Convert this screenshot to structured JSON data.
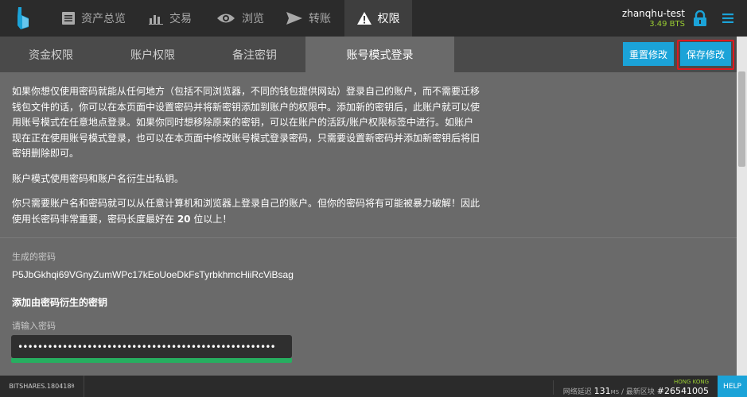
{
  "nav": {
    "items": [
      {
        "label": "资产总览",
        "icon": "dashboard-icon"
      },
      {
        "label": "交易",
        "icon": "chart-bars-icon"
      },
      {
        "label": "浏览",
        "icon": "eye-icon"
      },
      {
        "label": "转账",
        "icon": "send-arrow-icon"
      },
      {
        "label": "权限",
        "icon": "warning-icon",
        "active": true
      }
    ]
  },
  "user": {
    "name": "zhanqhu-test",
    "balance": "3.49 BTS"
  },
  "tabs": [
    {
      "label": "资金权限"
    },
    {
      "label": "账户权限"
    },
    {
      "label": "备注密钥"
    },
    {
      "label": "账号模式登录",
      "active": true
    }
  ],
  "buttons": {
    "reset": "重置修改",
    "save": "保存修改"
  },
  "content": {
    "intro": "如果你想仅使用密码就能从任何地方（包括不同浏览器，不同的钱包提供网站）登录自己的账户，而不需要迁移钱包文件的话，你可以在本页面中设置密码并将新密钥添加到账户的权限中。添加新的密钥后，此账户就可以使用账号模式在任意地点登录。如果你同时想移除原来的密钥，可以在账户的活跃/账户权限标签中进行。如账户现在正在使用账号模式登录，也可以在本页面中修改账号模式登录密码，只需要设置新密码并添加新密钥后将旧密钥删除即可。",
    "note1": "账户模式使用密码和账户名衍生出私钥。",
    "note2_before": "你只需要账户名和密码就可以从任意计算机和浏览器上登录自己的账户。但你的密码将有可能被暴力破解！因此使用长密码非常重要，密码长度最好在 ",
    "note2_bold": "20",
    "note2_after": " 位以上！",
    "generated_label": "生成的密码",
    "generated_password": "P5JbGkhqi69VGnyZumWPc17kEoUoeDkFsTyrbkhmcHiiRcViBsag",
    "add_key_title": "添加由密码衍生的密钥",
    "input_label": "请输入密码",
    "input_value": "••••••••••••••••••••••••••••••••••••••••••••••••••••"
  },
  "footer": {
    "version": "BITSHARES.180418",
    "version_suffix": "B",
    "location": "HONG KONG",
    "latency_label": "网络延迟",
    "latency_value": "131",
    "latency_unit": "MS",
    "block_label": "/ 最新区块",
    "block_value": "#26541005",
    "help": "HELP"
  },
  "colors": {
    "accent": "#1ba3d8",
    "highlight": "#e0181f",
    "balance": "#9acd32",
    "strength": "#27ae60",
    "topbar": "#2b2b2b",
    "content_bg": "#6a6a6a"
  }
}
